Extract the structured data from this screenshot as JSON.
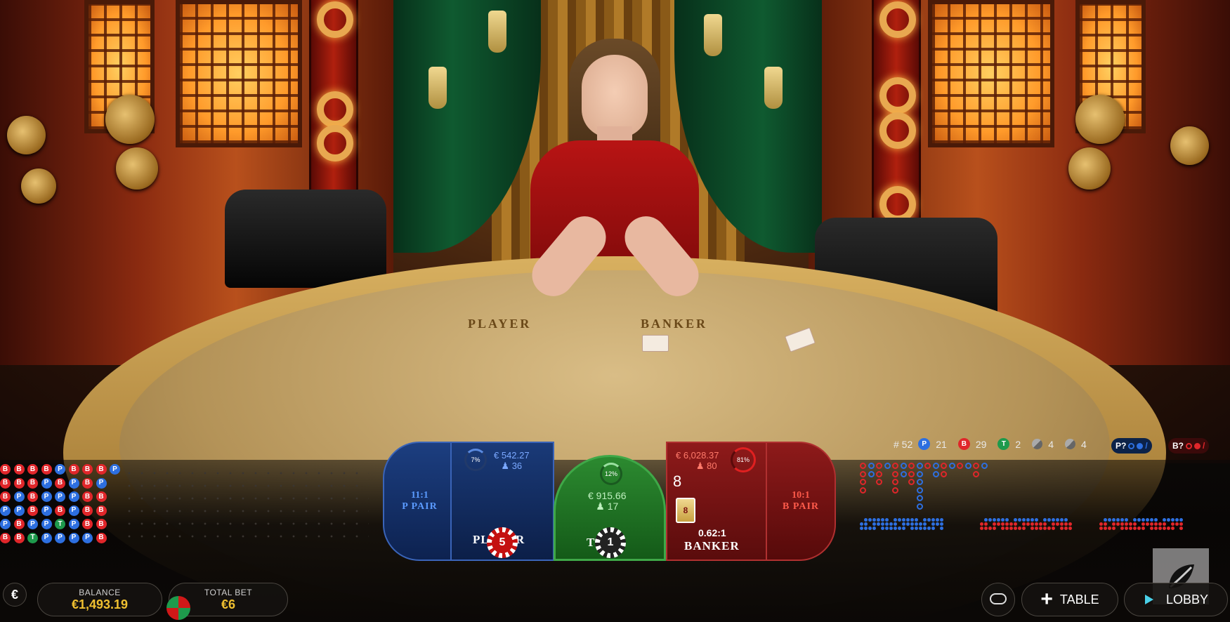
{
  "table": {
    "player_label": "PLAYER",
    "banker_label": "BANKER"
  },
  "bead_road": [
    [
      "B",
      "B",
      "B",
      "P",
      "P",
      "B"
    ],
    [
      "B",
      "B",
      "P",
      "P",
      "B",
      "B"
    ],
    [
      "B",
      "B",
      "B",
      "B",
      "P",
      "T"
    ],
    [
      "B",
      "P",
      "P",
      "P",
      "P",
      "P"
    ],
    [
      "P",
      "B",
      "P",
      "B",
      "T",
      "P"
    ],
    [
      "B",
      "P",
      "P",
      "P",
      "P",
      "P"
    ],
    [
      "B",
      "B",
      "B",
      "B",
      "B",
      "P"
    ],
    [
      "B",
      "P",
      "B",
      "B",
      "B",
      "B"
    ],
    [
      "P"
    ]
  ],
  "stats": {
    "shoe_number": "# 52",
    "player_count": "21",
    "banker_count": "29",
    "tie_count": "2",
    "player_pair_count": "4",
    "banker_pair_count": "4",
    "player_ask": "P?",
    "banker_ask": "B?"
  },
  "bets": {
    "player_pair": {
      "odds": "11:1",
      "label": "P PAIR"
    },
    "player": {
      "percent": "7%",
      "amount": "€ 542.27",
      "players": "36",
      "label": "PLAYER",
      "chip": "5"
    },
    "tie": {
      "percent": "12%",
      "amount": "€ 915.66",
      "players": "17",
      "label": "TIE 1",
      "chip": "1"
    },
    "banker": {
      "percent": "81%",
      "amount": "€ 6,028.37",
      "players": "80",
      "score": "8",
      "odds": "0.62:1",
      "label": "BANKER",
      "card": "8"
    },
    "banker_pair": {
      "odds": "10:1",
      "label": "B PAIR"
    }
  },
  "footer": {
    "currency": "€",
    "balance_label": "BALANCE",
    "balance": "€1,493.19",
    "total_bet_label": "TOTAL BET",
    "total_bet": "€6",
    "table_label": "TABLE",
    "lobby_label": "LOBBY"
  },
  "icons": {
    "currency": "euro-icon",
    "chat": "chat-icon",
    "table": "plus-icon",
    "lobby": "lobby-icon",
    "players": "user-icon"
  },
  "colors": {
    "player": "#2d6fe0",
    "banker": "#e0262a",
    "tie": "#1e9a4c",
    "balance": "#f0c030"
  }
}
